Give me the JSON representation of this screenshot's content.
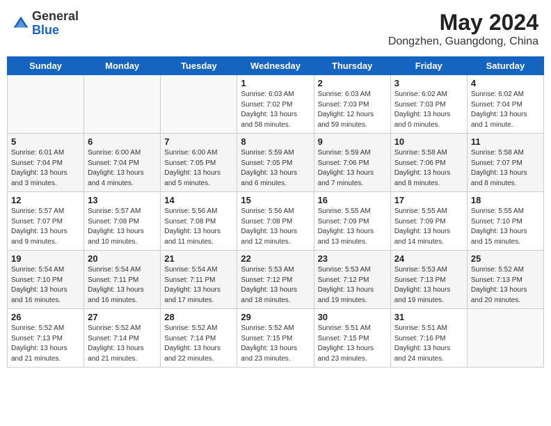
{
  "header": {
    "logo_general": "General",
    "logo_blue": "Blue",
    "month_year": "May 2024",
    "location": "Dongzhen, Guangdong, China"
  },
  "weekdays": [
    "Sunday",
    "Monday",
    "Tuesday",
    "Wednesday",
    "Thursday",
    "Friday",
    "Saturday"
  ],
  "weeks": [
    [
      {
        "day": "",
        "info": ""
      },
      {
        "day": "",
        "info": ""
      },
      {
        "day": "",
        "info": ""
      },
      {
        "day": "1",
        "info": "Sunrise: 6:03 AM\nSunset: 7:02 PM\nDaylight: 13 hours\nand 58 minutes."
      },
      {
        "day": "2",
        "info": "Sunrise: 6:03 AM\nSunset: 7:03 PM\nDaylight: 12 hours\nand 59 minutes."
      },
      {
        "day": "3",
        "info": "Sunrise: 6:02 AM\nSunset: 7:03 PM\nDaylight: 13 hours\nand 0 minutes."
      },
      {
        "day": "4",
        "info": "Sunrise: 6:02 AM\nSunset: 7:04 PM\nDaylight: 13 hours\nand 1 minute."
      }
    ],
    [
      {
        "day": "5",
        "info": "Sunrise: 6:01 AM\nSunset: 7:04 PM\nDaylight: 13 hours\nand 3 minutes."
      },
      {
        "day": "6",
        "info": "Sunrise: 6:00 AM\nSunset: 7:04 PM\nDaylight: 13 hours\nand 4 minutes."
      },
      {
        "day": "7",
        "info": "Sunrise: 6:00 AM\nSunset: 7:05 PM\nDaylight: 13 hours\nand 5 minutes."
      },
      {
        "day": "8",
        "info": "Sunrise: 5:59 AM\nSunset: 7:05 PM\nDaylight: 13 hours\nand 6 minutes."
      },
      {
        "day": "9",
        "info": "Sunrise: 5:59 AM\nSunset: 7:06 PM\nDaylight: 13 hours\nand 7 minutes."
      },
      {
        "day": "10",
        "info": "Sunrise: 5:58 AM\nSunset: 7:06 PM\nDaylight: 13 hours\nand 8 minutes."
      },
      {
        "day": "11",
        "info": "Sunrise: 5:58 AM\nSunset: 7:07 PM\nDaylight: 13 hours\nand 8 minutes."
      }
    ],
    [
      {
        "day": "12",
        "info": "Sunrise: 5:57 AM\nSunset: 7:07 PM\nDaylight: 13 hours\nand 9 minutes."
      },
      {
        "day": "13",
        "info": "Sunrise: 5:57 AM\nSunset: 7:08 PM\nDaylight: 13 hours\nand 10 minutes."
      },
      {
        "day": "14",
        "info": "Sunrise: 5:56 AM\nSunset: 7:08 PM\nDaylight: 13 hours\nand 11 minutes."
      },
      {
        "day": "15",
        "info": "Sunrise: 5:56 AM\nSunset: 7:08 PM\nDaylight: 13 hours\nand 12 minutes."
      },
      {
        "day": "16",
        "info": "Sunrise: 5:55 AM\nSunset: 7:09 PM\nDaylight: 13 hours\nand 13 minutes."
      },
      {
        "day": "17",
        "info": "Sunrise: 5:55 AM\nSunset: 7:09 PM\nDaylight: 13 hours\nand 14 minutes."
      },
      {
        "day": "18",
        "info": "Sunrise: 5:55 AM\nSunset: 7:10 PM\nDaylight: 13 hours\nand 15 minutes."
      }
    ],
    [
      {
        "day": "19",
        "info": "Sunrise: 5:54 AM\nSunset: 7:10 PM\nDaylight: 13 hours\nand 16 minutes."
      },
      {
        "day": "20",
        "info": "Sunrise: 5:54 AM\nSunset: 7:11 PM\nDaylight: 13 hours\nand 16 minutes."
      },
      {
        "day": "21",
        "info": "Sunrise: 5:54 AM\nSunset: 7:11 PM\nDaylight: 13 hours\nand 17 minutes."
      },
      {
        "day": "22",
        "info": "Sunrise: 5:53 AM\nSunset: 7:12 PM\nDaylight: 13 hours\nand 18 minutes."
      },
      {
        "day": "23",
        "info": "Sunrise: 5:53 AM\nSunset: 7:12 PM\nDaylight: 13 hours\nand 19 minutes."
      },
      {
        "day": "24",
        "info": "Sunrise: 5:53 AM\nSunset: 7:13 PM\nDaylight: 13 hours\nand 19 minutes."
      },
      {
        "day": "25",
        "info": "Sunrise: 5:52 AM\nSunset: 7:13 PM\nDaylight: 13 hours\nand 20 minutes."
      }
    ],
    [
      {
        "day": "26",
        "info": "Sunrise: 5:52 AM\nSunset: 7:13 PM\nDaylight: 13 hours\nand 21 minutes."
      },
      {
        "day": "27",
        "info": "Sunrise: 5:52 AM\nSunset: 7:14 PM\nDaylight: 13 hours\nand 21 minutes."
      },
      {
        "day": "28",
        "info": "Sunrise: 5:52 AM\nSunset: 7:14 PM\nDaylight: 13 hours\nand 22 minutes."
      },
      {
        "day": "29",
        "info": "Sunrise: 5:52 AM\nSunset: 7:15 PM\nDaylight: 13 hours\nand 23 minutes."
      },
      {
        "day": "30",
        "info": "Sunrise: 5:51 AM\nSunset: 7:15 PM\nDaylight: 13 hours\nand 23 minutes."
      },
      {
        "day": "31",
        "info": "Sunrise: 5:51 AM\nSunset: 7:16 PM\nDaylight: 13 hours\nand 24 minutes."
      },
      {
        "day": "",
        "info": ""
      }
    ]
  ]
}
